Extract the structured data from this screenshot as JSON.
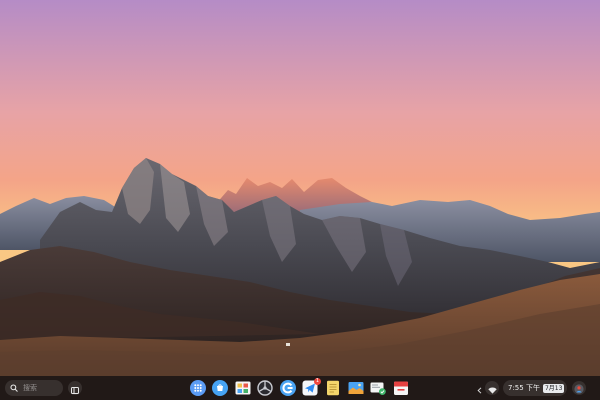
{
  "wallpaper": {
    "description_icon": "mountain-sunset-wallpaper",
    "sky_top": "#b58cc6",
    "sky_mid": "#f4a488",
    "sky_low": "#fac884",
    "range_far": "#6f7687",
    "range_near": "#4c4d56",
    "hills": "#5a3b2f",
    "ground": "#7e5a44",
    "peak_glow": "#e58a6e"
  },
  "shelf": {
    "background": "#181414",
    "search": {
      "icon": "search-icon",
      "placeholder": "搜索"
    },
    "overview_icon": "overview-windows-icon",
    "apps": [
      {
        "name": "launcher",
        "icon": "app-grid-icon",
        "color": "#5b9cf5"
      },
      {
        "name": "app-store",
        "icon": "store-icon",
        "color": "#46a3f3"
      },
      {
        "name": "gallery",
        "icon": "gallery-icon",
        "color": "#f0c24b"
      },
      {
        "name": "steering",
        "icon": "steering-wheel-icon",
        "color": "#c9cbd1"
      },
      {
        "name": "browser",
        "icon": "browser-icon",
        "color": "#4aa3f2"
      },
      {
        "name": "messenger",
        "icon": "paper-plane-icon",
        "color": "#2f8bf0",
        "badge": "1"
      },
      {
        "name": "notes",
        "icon": "notes-icon",
        "color": "#f3d56b"
      },
      {
        "name": "photos",
        "icon": "photos-icon",
        "color": "#f1a43a"
      },
      {
        "name": "files",
        "icon": "files-icon",
        "color": "#40b56b"
      },
      {
        "name": "calendar",
        "icon": "calendar-icon",
        "color": "#e64141"
      }
    ],
    "tray": {
      "chevron_icon": "chevron-left-icon",
      "wifi_icon": "wifi-icon",
      "time": "7:55 下午",
      "date": "7月13",
      "account_icon": "account-avatar-icon"
    }
  }
}
